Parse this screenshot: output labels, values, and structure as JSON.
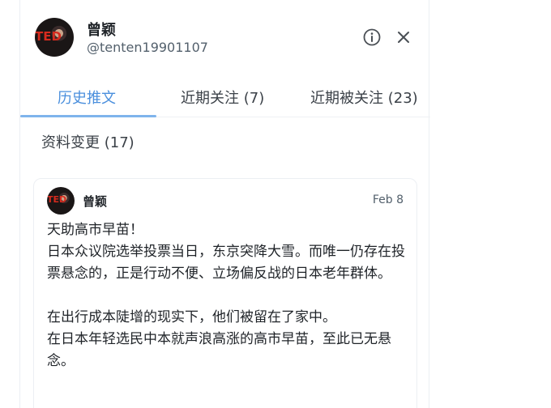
{
  "profile": {
    "name": "曾颖",
    "handle": "@tenten19901107",
    "avatar_text": "TED"
  },
  "icons": {
    "info": "info-circle-icon",
    "close": "close-icon"
  },
  "tabs": [
    {
      "label": "历史推文",
      "active": true
    },
    {
      "label": "近期关注 (7)",
      "active": false
    },
    {
      "label": "近期被关注 (23)",
      "active": false
    },
    {
      "label": "资料变更 (17)",
      "active": false
    }
  ],
  "tweet": {
    "author": "曾颖",
    "date": "Feb 8",
    "lines": [
      "天助高市早苗！",
      "日本众议院选举投票当日，东京突降大雪。而唯一仍存在投票悬念的，正是行动不便、立场偏反战的日本老年群体。",
      "在出行成本陡增的现实下，他们被留在了家中。",
      "在日本年轻选民中本就声浪高涨的高市早苗，至此已无悬念。"
    ]
  },
  "colors": {
    "accent": "#4a8fdd",
    "underline": "#7fb4ec",
    "text": "#1f2328",
    "muted": "#53606c"
  }
}
